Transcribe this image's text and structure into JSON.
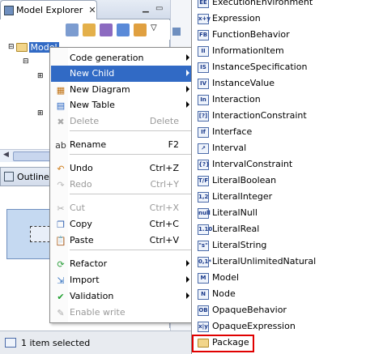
{
  "explorer": {
    "tab_title": "Model Explorer",
    "close_glyph": "✕",
    "tree_root_label": "Model"
  },
  "outline": {
    "tab_title": "Outline"
  },
  "status": {
    "text": "1 item selected"
  },
  "context_menu": {
    "items": [
      {
        "label": "Code generation",
        "accel": "",
        "submenu": true,
        "disabled": false,
        "icon": "blank"
      },
      {
        "label": "New Child",
        "accel": "",
        "submenu": true,
        "disabled": false,
        "icon": "blank",
        "highlighted": true
      },
      {
        "label": "New Diagram",
        "accel": "",
        "submenu": true,
        "disabled": false,
        "icon": "diagram-icon"
      },
      {
        "label": "New Table",
        "accel": "",
        "submenu": true,
        "disabled": false,
        "icon": "table-icon"
      },
      {
        "label": "Delete",
        "accel": "Delete",
        "submenu": false,
        "disabled": true,
        "icon": "delete-icon"
      },
      {
        "label": "Rename",
        "accel": "F2",
        "submenu": false,
        "disabled": false,
        "icon": "rename-icon"
      },
      {
        "label": "Undo",
        "accel": "Ctrl+Z",
        "submenu": false,
        "disabled": false,
        "icon": "undo-icon"
      },
      {
        "label": "Redo",
        "accel": "Ctrl+Y",
        "submenu": false,
        "disabled": true,
        "icon": "redo-icon"
      },
      {
        "label": "Cut",
        "accel": "Ctrl+X",
        "submenu": false,
        "disabled": true,
        "icon": "cut-icon"
      },
      {
        "label": "Copy",
        "accel": "Ctrl+C",
        "submenu": false,
        "disabled": false,
        "icon": "copy-icon"
      },
      {
        "label": "Paste",
        "accel": "Ctrl+V",
        "submenu": false,
        "disabled": false,
        "icon": "paste-icon"
      },
      {
        "label": "Refactor",
        "accel": "",
        "submenu": true,
        "disabled": false,
        "icon": "refactor-icon"
      },
      {
        "label": "Import",
        "accel": "",
        "submenu": true,
        "disabled": false,
        "icon": "import-icon"
      },
      {
        "label": "Validation",
        "accel": "",
        "submenu": true,
        "disabled": false,
        "icon": "validation-icon"
      },
      {
        "label": "Enable write",
        "accel": "",
        "submenu": false,
        "disabled": true,
        "icon": "pencil-icon"
      }
    ]
  },
  "submenu": {
    "items": [
      {
        "label": "ExecutionEnvironment",
        "icon_text": "EE"
      },
      {
        "label": "Expression",
        "icon_text": "x+y"
      },
      {
        "label": "FunctionBehavior",
        "icon_text": "FB"
      },
      {
        "label": "InformationItem",
        "icon_text": "II"
      },
      {
        "label": "InstanceSpecification",
        "icon_text": "IS"
      },
      {
        "label": "InstanceValue",
        "icon_text": "IV"
      },
      {
        "label": "Interaction",
        "icon_text": "In"
      },
      {
        "label": "InteractionConstraint",
        "icon_text": "[?]"
      },
      {
        "label": "Interface",
        "icon_text": "If"
      },
      {
        "label": "Interval",
        "icon_text": "↗"
      },
      {
        "label": "IntervalConstraint",
        "icon_text": "{?}"
      },
      {
        "label": "LiteralBoolean",
        "icon_text": "T/F"
      },
      {
        "label": "LiteralInteger",
        "icon_text": "1,2"
      },
      {
        "label": "LiteralNull",
        "icon_text": "null"
      },
      {
        "label": "LiteralReal",
        "icon_text": "1.10"
      },
      {
        "label": "LiteralString",
        "icon_text": "\"s\""
      },
      {
        "label": "LiteralUnlimitedNatural",
        "icon_text": "0,1*"
      },
      {
        "label": "Model",
        "icon_text": "M"
      },
      {
        "label": "Node",
        "icon_text": "N"
      },
      {
        "label": "OpaqueBehavior",
        "icon_text": "OB"
      },
      {
        "label": "OpaqueExpression",
        "icon_text": "x|y"
      },
      {
        "label": "Package",
        "icon_text": "folder"
      }
    ]
  },
  "colors": {
    "highlight": "#316ac5",
    "package_outline": "#e00000"
  }
}
